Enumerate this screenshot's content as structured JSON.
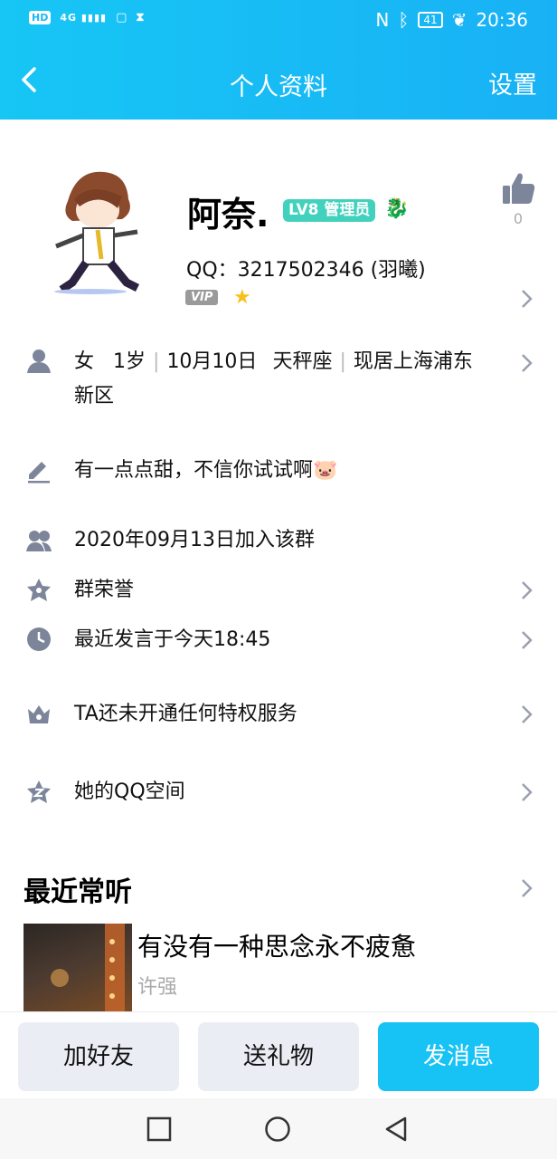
{
  "status_bar": {
    "left_badges": [
      "HD",
      "4G"
    ],
    "time": "20:36",
    "battery": "41"
  },
  "header": {
    "title": "个人资料",
    "settings_label": "设置"
  },
  "profile": {
    "name": "阿奈.",
    "level_badge": "LV8 管理员",
    "qq_line": "QQ：3217502346 (羽曦)",
    "vip_label": "VIP",
    "like_count": "0"
  },
  "rows": {
    "basic_info_line1_parts": [
      "女",
      "1岁",
      "10月10日",
      "天秤座",
      "现居上海浦东"
    ],
    "basic_info_line2": "新区",
    "signature": "有一点点甜，不信你试试啊🐷",
    "join_date": "2020年09月13日加入该群",
    "group_honor": "群荣誉",
    "last_spoke": "最近发言于今天18:45",
    "privilege": "TA还未开通任何特权服务",
    "qzone": "她的QQ空间"
  },
  "music": {
    "section_title": "最近常听",
    "song_title": "有没有一种思念永不疲惫",
    "artist": "许强"
  },
  "actions": {
    "add_friend": "加好友",
    "send_gift": "送礼物",
    "send_message": "发消息"
  },
  "colors": {
    "accent": "#17c2f5",
    "level_badge": "#41d1bd"
  }
}
